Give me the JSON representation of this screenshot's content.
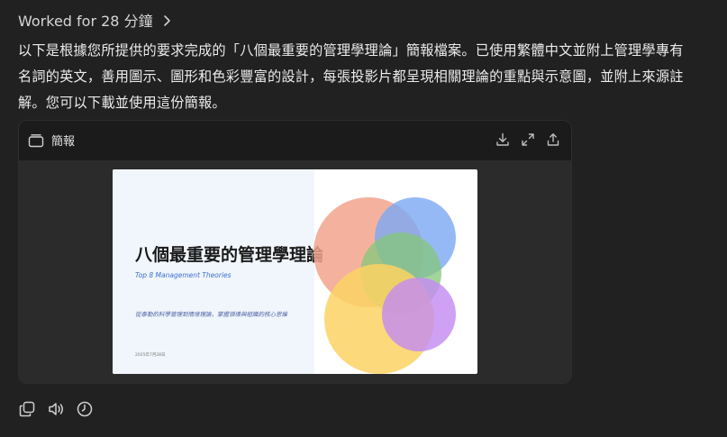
{
  "status": {
    "worked_label": "Worked for 28 分鐘"
  },
  "message": {
    "lines": [
      "以下是根據您所提供的要求完成的「八個最重要的管理學理論」簡報檔案。已使用繁體中文並附上管理學專有",
      "名詞的英文，善用圖示、圖形和色彩豐富的設計，每張投影片都呈現相關理論的重點與示意圖，並附上來源註",
      "解。您可以下載並使用這份簡報。"
    ]
  },
  "card": {
    "title": "簡報",
    "icons": [
      "slides-icon",
      "download-icon",
      "expand-icon",
      "share-icon"
    ]
  },
  "slide": {
    "title": "八個最重要的管理學理論",
    "subtitle": "Top 8 Management Theories",
    "tagline": "從泰勒的科學管理到情境理論，掌握領導與組織的核心思維",
    "date": "2025年7月28日",
    "circle_colors": [
      "#f2a48d",
      "#7aa7f2",
      "#84c77a",
      "#fcd264",
      "#c38af2"
    ]
  },
  "actions": {
    "icons": [
      "copy-icon",
      "speaker-icon",
      "history-icon"
    ]
  }
}
